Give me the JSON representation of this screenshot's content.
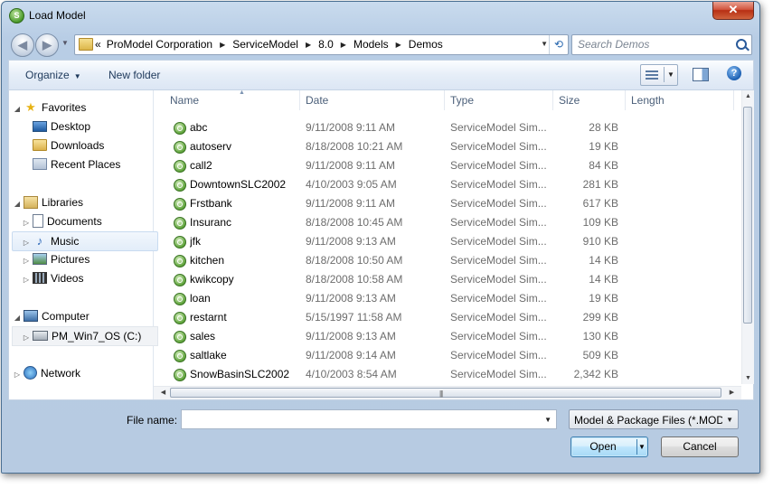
{
  "window": {
    "title": "Load Model",
    "app_icon": "S",
    "close_label": "✕"
  },
  "nav": {
    "back_glyph": "◀",
    "forward_glyph": "▶",
    "breadcrumb_lead": "«",
    "breadcrumb": [
      "ProModel Corporation",
      "ServiceModel",
      "8.0",
      "Models",
      "Demos"
    ],
    "search_placeholder": "Search Demos"
  },
  "toolbar": {
    "organize_label": "Organize",
    "new_folder_label": "New folder",
    "help_label": "?"
  },
  "sidebar": {
    "favorites_label": "Favorites",
    "favorites": [
      "Desktop",
      "Downloads",
      "Recent Places"
    ],
    "libraries_label": "Libraries",
    "libraries": [
      "Documents",
      "Music",
      "Pictures",
      "Videos"
    ],
    "computer_label": "Computer",
    "computer_items": [
      "PM_Win7_OS (C:)"
    ],
    "network_label": "Network"
  },
  "columns": {
    "name": "Name",
    "date": "Date",
    "type": "Type",
    "size": "Size",
    "length": "Length"
  },
  "files": [
    {
      "name": "abc",
      "date": "9/11/2008 9:11 AM",
      "type": "ServiceModel Sim...",
      "size": "28 KB"
    },
    {
      "name": "autoserv",
      "date": "8/18/2008 10:21 AM",
      "type": "ServiceModel Sim...",
      "size": "19 KB"
    },
    {
      "name": "call2",
      "date": "9/11/2008 9:11 AM",
      "type": "ServiceModel Sim...",
      "size": "84 KB"
    },
    {
      "name": "DowntownSLC2002",
      "date": "4/10/2003 9:05 AM",
      "type": "ServiceModel Sim...",
      "size": "281 KB"
    },
    {
      "name": "Frstbank",
      "date": "9/11/2008 9:11 AM",
      "type": "ServiceModel Sim...",
      "size": "617 KB"
    },
    {
      "name": "Insuranc",
      "date": "8/18/2008 10:45 AM",
      "type": "ServiceModel Sim...",
      "size": "109 KB"
    },
    {
      "name": "jfk",
      "date": "9/11/2008 9:13 AM",
      "type": "ServiceModel Sim...",
      "size": "910 KB"
    },
    {
      "name": "kitchen",
      "date": "8/18/2008 10:50 AM",
      "type": "ServiceModel Sim...",
      "size": "14 KB"
    },
    {
      "name": "kwikcopy",
      "date": "8/18/2008 10:58 AM",
      "type": "ServiceModel Sim...",
      "size": "14 KB"
    },
    {
      "name": "loan",
      "date": "9/11/2008 9:13 AM",
      "type": "ServiceModel Sim...",
      "size": "19 KB"
    },
    {
      "name": "restarnt",
      "date": "5/15/1997 11:58 AM",
      "type": "ServiceModel Sim...",
      "size": "299 KB"
    },
    {
      "name": "sales",
      "date": "9/11/2008 9:13 AM",
      "type": "ServiceModel Sim...",
      "size": "130 KB"
    },
    {
      "name": "saltlake",
      "date": "9/11/2008 9:14 AM",
      "type": "ServiceModel Sim...",
      "size": "509 KB"
    },
    {
      "name": "SnowBasinSLC2002",
      "date": "4/10/2003 8:54 AM",
      "type": "ServiceModel Sim...",
      "size": "2,342 KB"
    }
  ],
  "footer": {
    "filename_label": "File name:",
    "filename_value": "",
    "filter_value": "Model & Package Files (*.MOD, *.SPK)",
    "open_label": "Open",
    "cancel_label": "Cancel"
  },
  "colors": {
    "accent": "#3c7fb1",
    "chrome": "#b8cde5"
  }
}
